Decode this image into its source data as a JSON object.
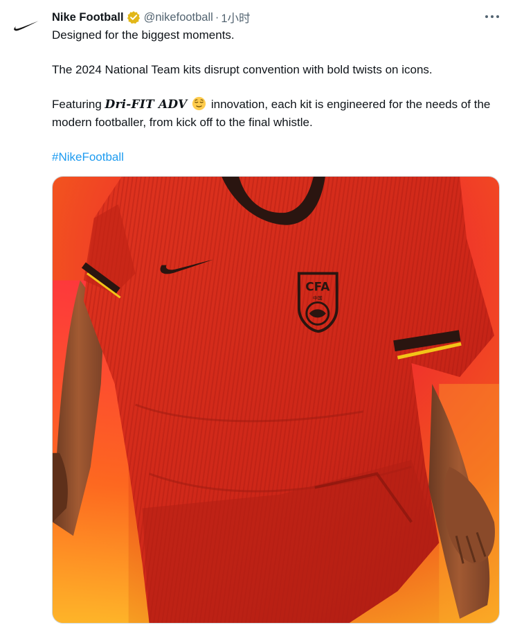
{
  "tweet": {
    "display_name": "Nike Football",
    "handle": "@nikefootball",
    "separator": "·",
    "timestamp": "1小时",
    "verified": true,
    "more_icon": "more-horizontal-icon",
    "avatar_icon": "nike-swoosh-logo",
    "text": {
      "line1": "Designed for the biggest moments.",
      "line2": "The 2024 National Team kits disrupt convention with bold twists on icons.",
      "line3_prefix": "Featuring ",
      "line3_brand": "Dri-FIT ADV",
      "line3_suffix": " innovation, each kit is engineered for the needs of the modern footballer, from kick off to the final whistle.",
      "emoji": "relieved-face-emoji",
      "hashtag": "#NikeFootball"
    },
    "media": {
      "crest_text": "CFA",
      "crest_subtext": "中国"
    }
  },
  "colors": {
    "text": "#0f1419",
    "secondary": "#536471",
    "link": "#1d9bf0",
    "verified_gold": "#e2b719",
    "jersey_red": "#d3281c",
    "trim_black": "#2a1510",
    "trim_yellow": "#f2c418"
  }
}
